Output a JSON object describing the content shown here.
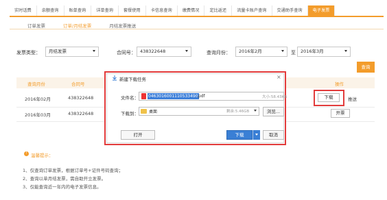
{
  "topnav": {
    "tabs": [
      "实时话费",
      "余额查询",
      "账单查询",
      "详单查询",
      "套餐使用",
      "卡信息查询",
      "缴费情况",
      "定比返还",
      "流量卡账户查询",
      "交通助手查询",
      "电子发票"
    ],
    "active_index": 10
  },
  "subtabs": {
    "items": [
      "订单发票",
      "订单/月结发票",
      "月结发票推送"
    ],
    "active_index": 1
  },
  "filters": {
    "invoice_type_label": "发票类型：",
    "invoice_type_value": "月结发票",
    "contract_label": "合同号：",
    "contract_value": "438322648",
    "month_label": "查询月份：",
    "month_from": "2016年2月",
    "to_label": "至",
    "month_to": "2016年3月",
    "query_button": "查询"
  },
  "table": {
    "headers": [
      "查询月份",
      "合同号",
      "操作"
    ],
    "rows": [
      {
        "month": "2016年02月",
        "contract": "438322648",
        "download": "下载",
        "push": "推送"
      },
      {
        "month": "2016年03月",
        "contract": "438322648",
        "open": "开票"
      }
    ]
  },
  "notice": {
    "title": "温馨提示：",
    "lines": [
      "1、仅查询订单发票，根据订单号+证件号码查询；",
      "2、查询以单月结发票，需自助开立发票。",
      "3、仅能查询近一年内的电子发票信息。"
    ]
  },
  "dialog": {
    "title": "新建下载任务",
    "filename_label": "文件名：",
    "filename_selected": "0463016001110533490",
    "filename_ext": ".pdf",
    "filesize": "大小:58.43KB",
    "download_to_label": "下载到：",
    "path": "桌面",
    "free_space": "剩余:5.46GB",
    "browse_button": "浏览...",
    "open_button": "打开",
    "download_button": "下载",
    "cancel_button": "取消"
  },
  "colors": {
    "accent": "#f39c2b",
    "highlight_border": "#e23b3b",
    "primary_blue": "#3a7fd5"
  }
}
